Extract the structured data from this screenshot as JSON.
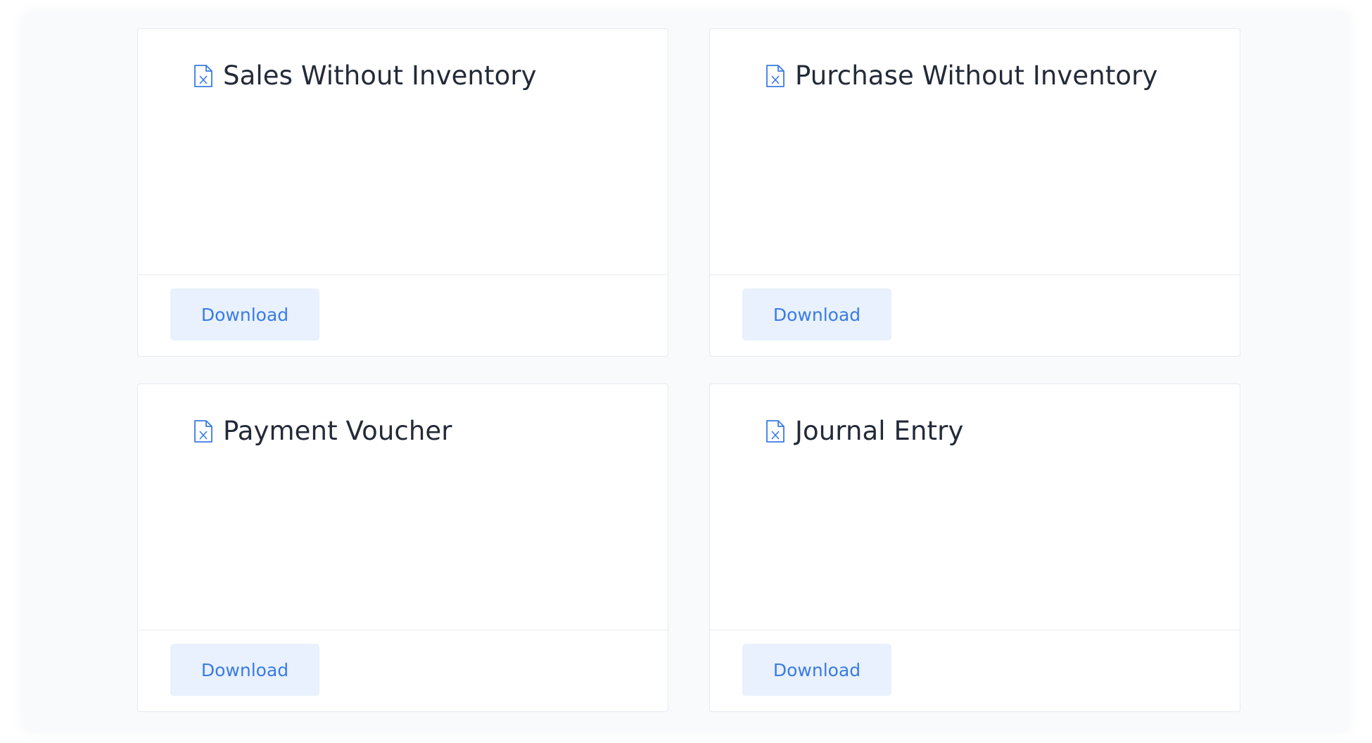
{
  "cards": [
    {
      "title": "Sales Without Inventory",
      "button_label": "Download",
      "icon": "excel-file-icon"
    },
    {
      "title": "Purchase Without Inventory",
      "button_label": "Download",
      "icon": "excel-file-icon"
    },
    {
      "title": "Payment Voucher",
      "button_label": "Download",
      "icon": "excel-file-icon"
    },
    {
      "title": "Journal Entry",
      "button_label": "Download",
      "icon": "excel-file-icon"
    }
  ],
  "colors": {
    "accent": "#3a7be3",
    "button_bg": "#e8f1fd",
    "panel_bg": "#f8fafc",
    "title_text": "#232a38"
  }
}
